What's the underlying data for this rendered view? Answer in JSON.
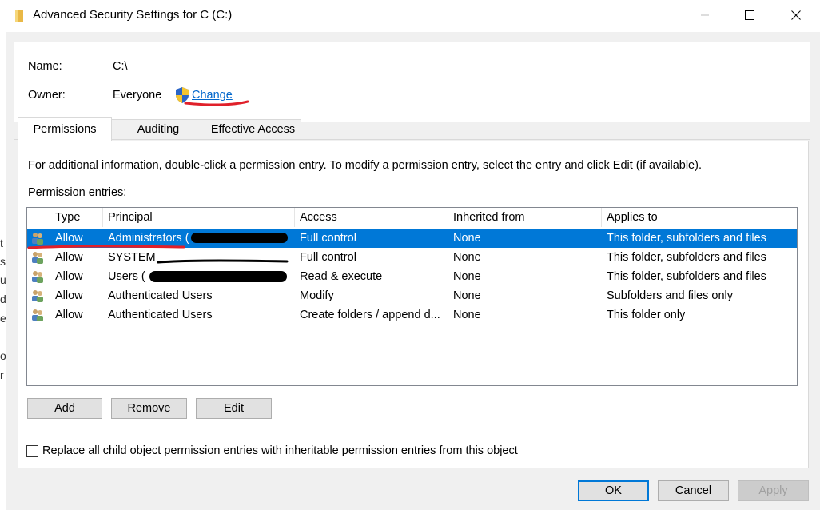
{
  "window": {
    "title": "Advanced Security Settings for C (C:)"
  },
  "info": {
    "name_label": "Name:",
    "name_value": "C:\\",
    "owner_label": "Owner:",
    "owner_value": "Everyone",
    "change_link": "Change"
  },
  "tabs": [
    {
      "label": "Permissions",
      "active": true
    },
    {
      "label": "Auditing",
      "active": false
    },
    {
      "label": "Effective Access",
      "active": false
    }
  ],
  "instructions": "For additional information, double-click a permission entry. To modify a permission entry, select the entry and click Edit (if available).",
  "entries_label": "Permission entries:",
  "columns": [
    "Type",
    "Principal",
    "Access",
    "Inherited from",
    "Applies to"
  ],
  "rows": [
    {
      "type": "Allow",
      "principal": "Administrators (",
      "access": "Full control",
      "inherited": "None",
      "applies": "This folder, subfolders and files",
      "selected": true
    },
    {
      "type": "Allow",
      "principal": "SYSTEM",
      "access": "Full control",
      "inherited": "None",
      "applies": "This folder, subfolders and files",
      "selected": false
    },
    {
      "type": "Allow",
      "principal": "Users (",
      "access": "Read & execute",
      "inherited": "None",
      "applies": "This folder, subfolders and files",
      "selected": false
    },
    {
      "type": "Allow",
      "principal": "Authenticated Users",
      "access": "Modify",
      "inherited": "None",
      "applies": "Subfolders and files only",
      "selected": false
    },
    {
      "type": "Allow",
      "principal": "Authenticated Users",
      "access": "Create folders / append d...",
      "inherited": "None",
      "applies": "This folder only",
      "selected": false
    }
  ],
  "buttons": {
    "add": "Add",
    "remove": "Remove",
    "edit": "Edit",
    "ok": "OK",
    "cancel": "Cancel",
    "apply": "Apply"
  },
  "replace_checkbox": {
    "label": "Replace all child object permission entries with inheritable permission entries from this object",
    "checked": false
  },
  "background_chars": [
    "t",
    "s",
    "u",
    "d",
    "e",
    "o",
    "r"
  ],
  "icons": {
    "folder": "folder-icon",
    "shield": "uac-shield-icon",
    "user": "users-group-icon"
  },
  "colors": {
    "accent": "#0078d7",
    "link": "#0066cc",
    "annotation": "#e0202a"
  }
}
